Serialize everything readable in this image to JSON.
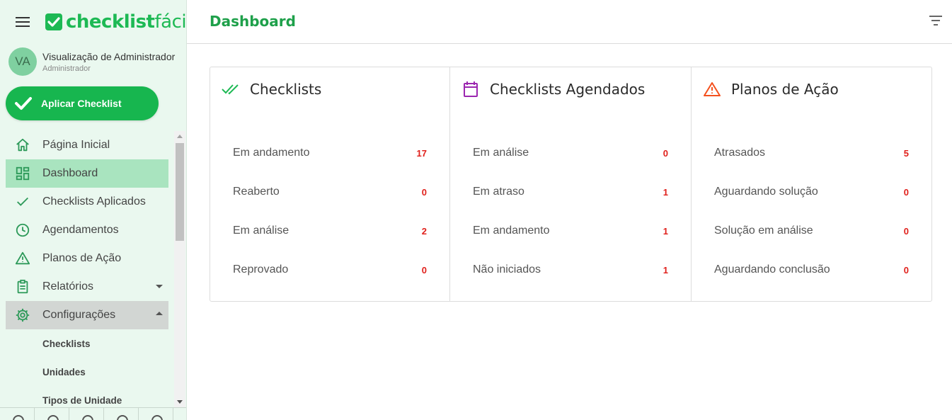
{
  "app": {
    "logo_bold": "checklist",
    "logo_light": "fácil"
  },
  "user": {
    "initials": "VA",
    "name": "Visualização de Administrador",
    "role": "Administrador"
  },
  "apply_button": {
    "label": "Aplicar Checklist"
  },
  "sidebar": {
    "items": [
      {
        "label": "Página Inicial",
        "icon": "home-icon"
      },
      {
        "label": "Dashboard",
        "icon": "dashboard-icon",
        "active": true
      },
      {
        "label": "Checklists Aplicados",
        "icon": "check-icon"
      },
      {
        "label": "Agendamentos",
        "icon": "clock-icon"
      },
      {
        "label": "Planos de Ação",
        "icon": "warning-icon"
      },
      {
        "label": "Relatórios",
        "icon": "clipboard-icon"
      },
      {
        "label": "Configurações",
        "icon": "gear-icon"
      }
    ],
    "sub_items": [
      {
        "label": "Checklists"
      },
      {
        "label": "Unidades"
      },
      {
        "label": "Tipos de Unidade"
      }
    ]
  },
  "header": {
    "title": "Dashboard",
    "filter_icon": "filter-icon"
  },
  "cards": [
    {
      "title": "Checklists",
      "icon": "double-check-icon",
      "icon_color": "#1db954",
      "rows": [
        {
          "label": "Em andamento",
          "value": "17"
        },
        {
          "label": "Reaberto",
          "value": "0"
        },
        {
          "label": "Em análise",
          "value": "2"
        },
        {
          "label": "Reprovado",
          "value": "0"
        }
      ]
    },
    {
      "title": "Checklists Agendados",
      "icon": "calendar-icon",
      "icon_color": "#9c27b0",
      "rows": [
        {
          "label": "Em análise",
          "value": "0"
        },
        {
          "label": "Em atraso",
          "value": "1"
        },
        {
          "label": "Em andamento",
          "value": "1"
        },
        {
          "label": "Não iniciados",
          "value": "1"
        }
      ]
    },
    {
      "title": "Planos de Ação",
      "icon": "warning-icon",
      "icon_color": "#f4511e",
      "rows": [
        {
          "label": "Atrasados",
          "value": "5"
        },
        {
          "label": "Aguardando solução",
          "value": "0"
        },
        {
          "label": "Solução em análise",
          "value": "0"
        },
        {
          "label": "Aguardando conclusão",
          "value": "0"
        }
      ]
    }
  ],
  "colors": {
    "brand": "#1db954",
    "sidebar_bg": "#eaf8ef",
    "active_item": "#a9e4bf",
    "value_red": "#e0201b"
  }
}
